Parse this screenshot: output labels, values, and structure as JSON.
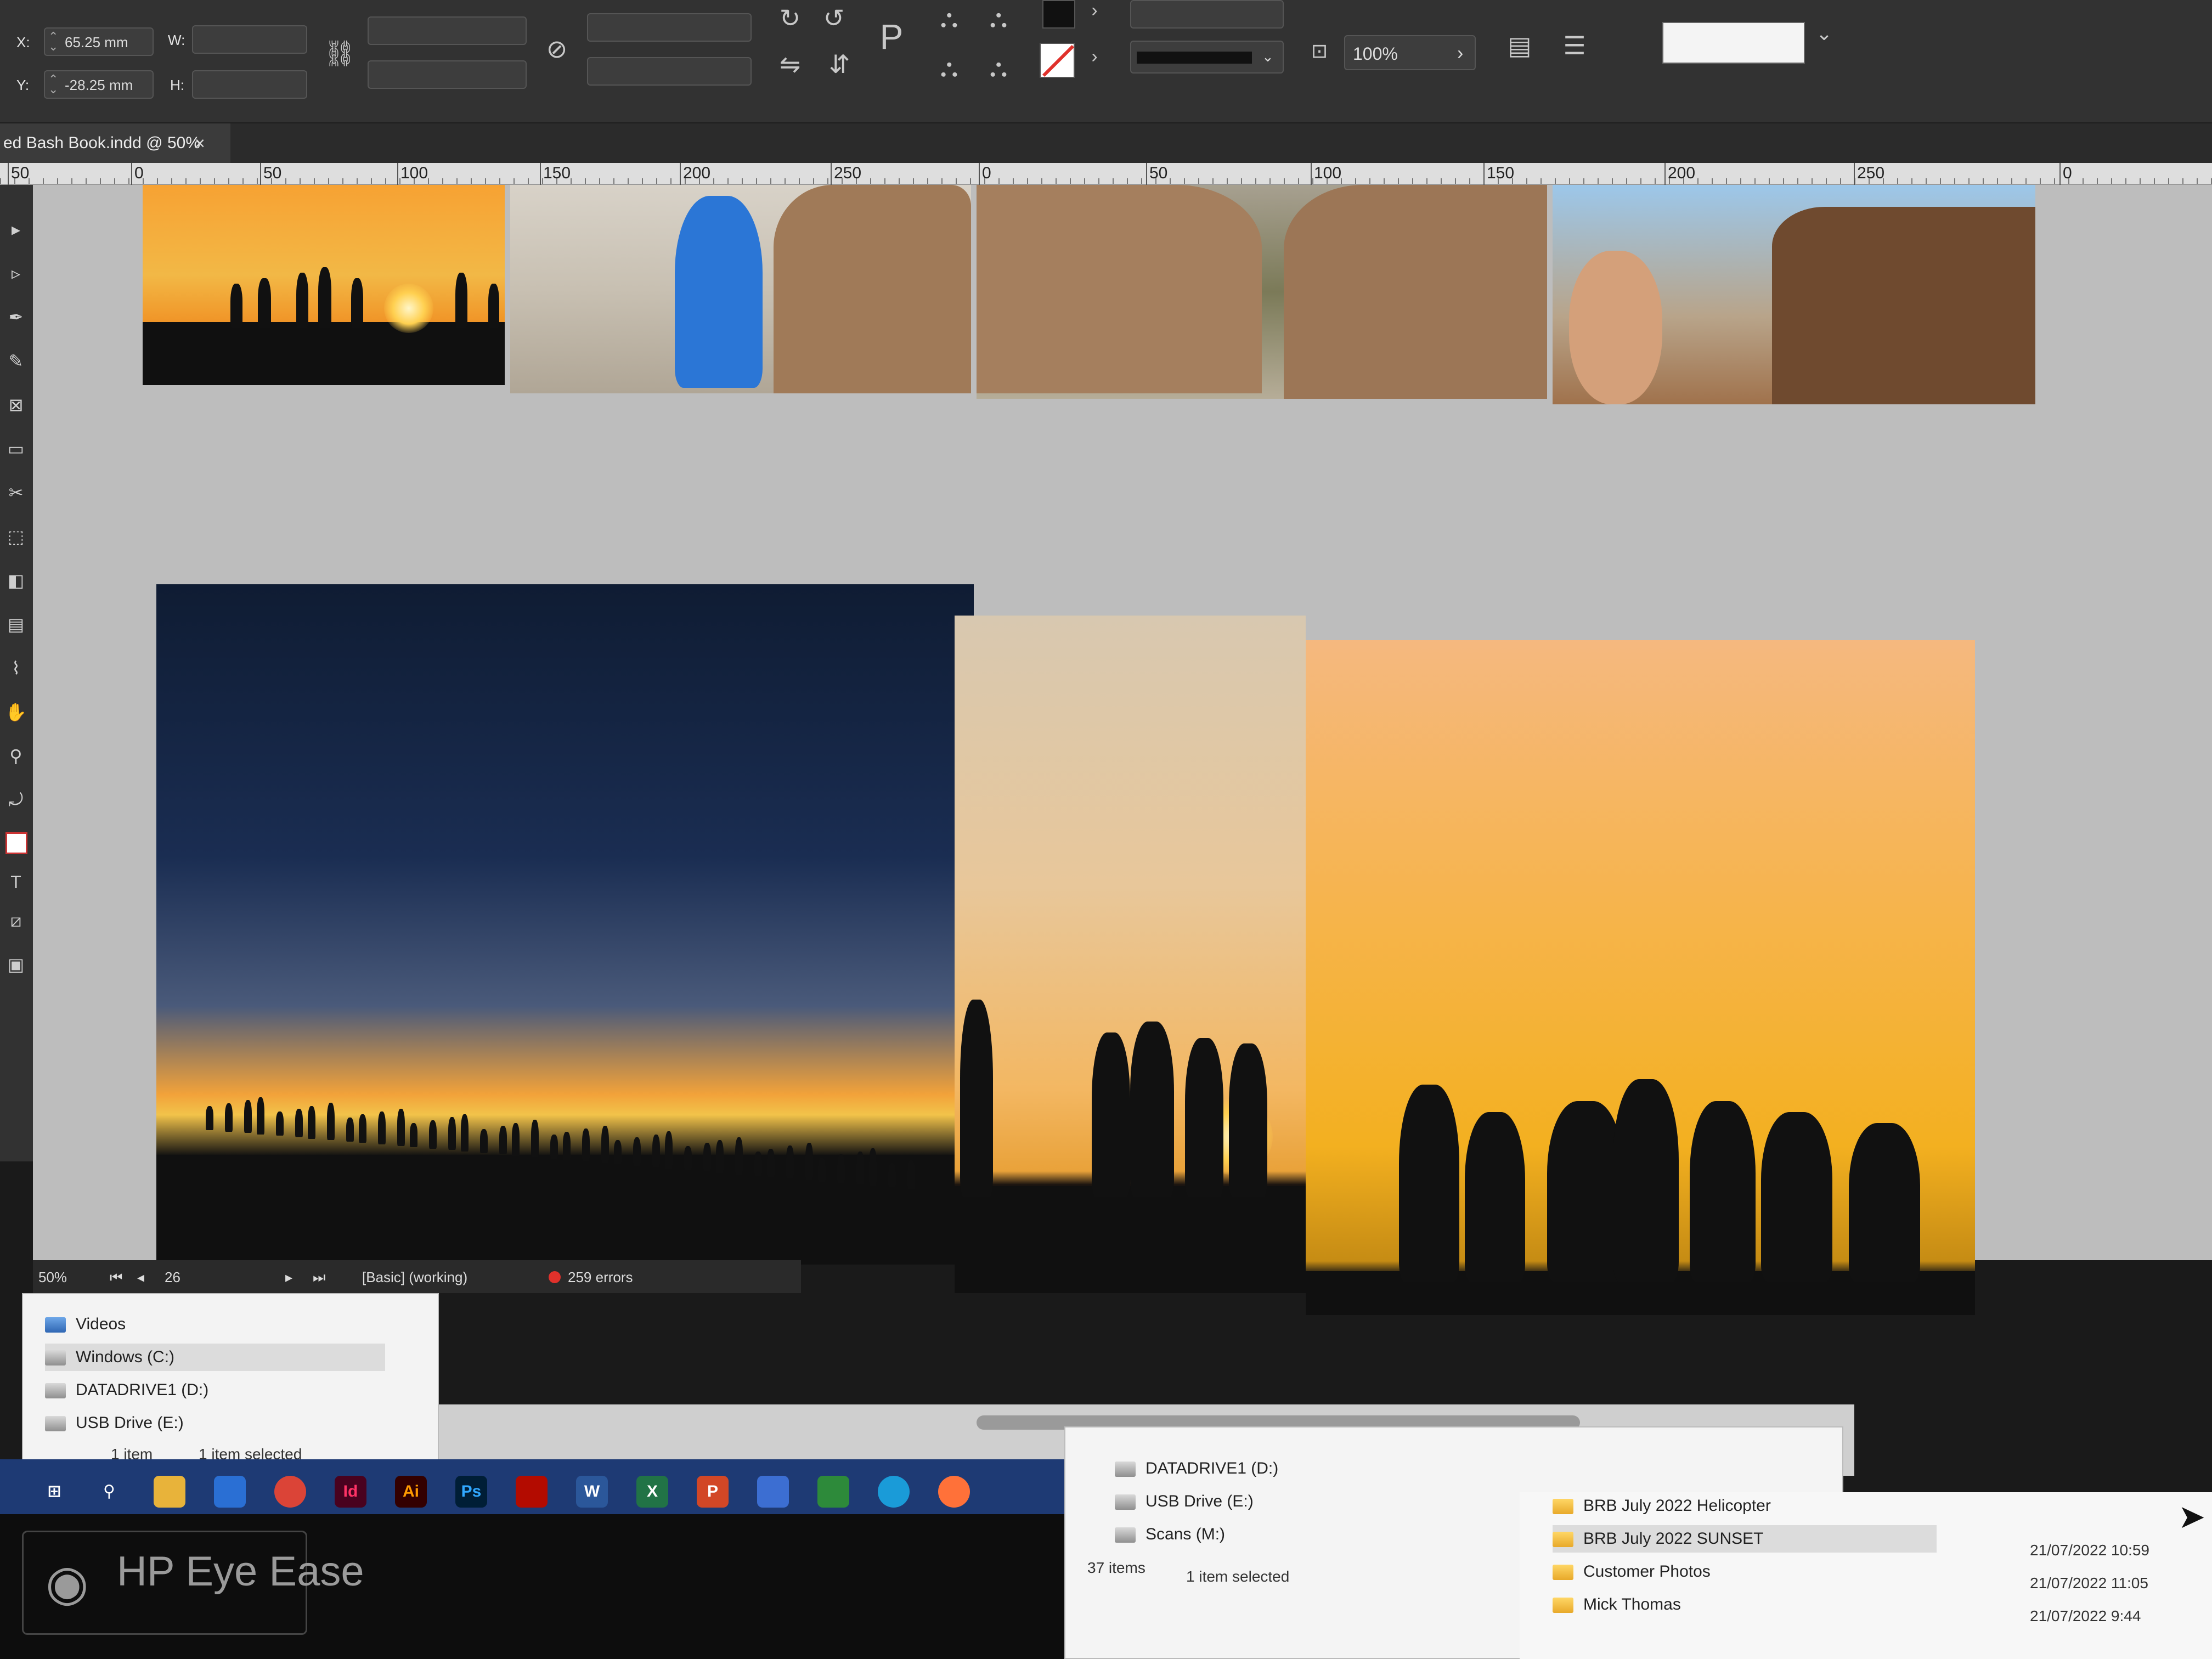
{
  "control_bar": {
    "x_label": "X:",
    "x_value": "65.25 mm",
    "y_label": "Y:",
    "y_value": "-28.25 mm",
    "w_label": "W:",
    "h_label": "H:",
    "zoom_field": "100%",
    "type_p": "P"
  },
  "document_tab": {
    "title": "ed Bash Book.indd @ 50%",
    "close": "×"
  },
  "ruler": {
    "labels": [
      "50",
      "0",
      "50",
      "100",
      "150",
      "200",
      "250",
      "0",
      "50",
      "100",
      "150",
      "200",
      "250",
      "0"
    ]
  },
  "status_bar": {
    "zoom": "50%",
    "page": "26",
    "profile": "[Basic] (working)",
    "errors": "259 errors"
  },
  "explorer_left": {
    "items": [
      "Videos",
      "Windows (C:)",
      "DATADRIVE1 (D:)",
      "USB Drive (E:)"
    ],
    "status_count": "1 item",
    "status_selected": "1 item selected"
  },
  "explorer_mid": {
    "items": [
      "DATADRIVE1 (D:)",
      "USB Drive (E:)",
      "Scans (M:)"
    ],
    "status_count": "37 items",
    "status_selected": "1 item selected"
  },
  "explorer_right": {
    "folders": [
      "BRB July 2022 Helicopter",
      "BRB July 2022 SUNSET",
      "Customer Photos",
      "Mick Thomas"
    ],
    "dates": [
      "21/07/2022 10:59",
      "21/07/2022 11:05",
      "21/07/2022 9:44"
    ]
  },
  "taskbar": {
    "apps": [
      "Id",
      "Ai",
      "Ps",
      "W",
      "X",
      "P"
    ]
  },
  "monitor": {
    "badge": "HP Eye Ease"
  },
  "colors": {
    "ui_dark": "#323232",
    "pasteboard": "#bdbdbd",
    "taskbar": "#1e3a74",
    "error_dot": "#e0312b",
    "sunset_orange": "#f3a426"
  }
}
